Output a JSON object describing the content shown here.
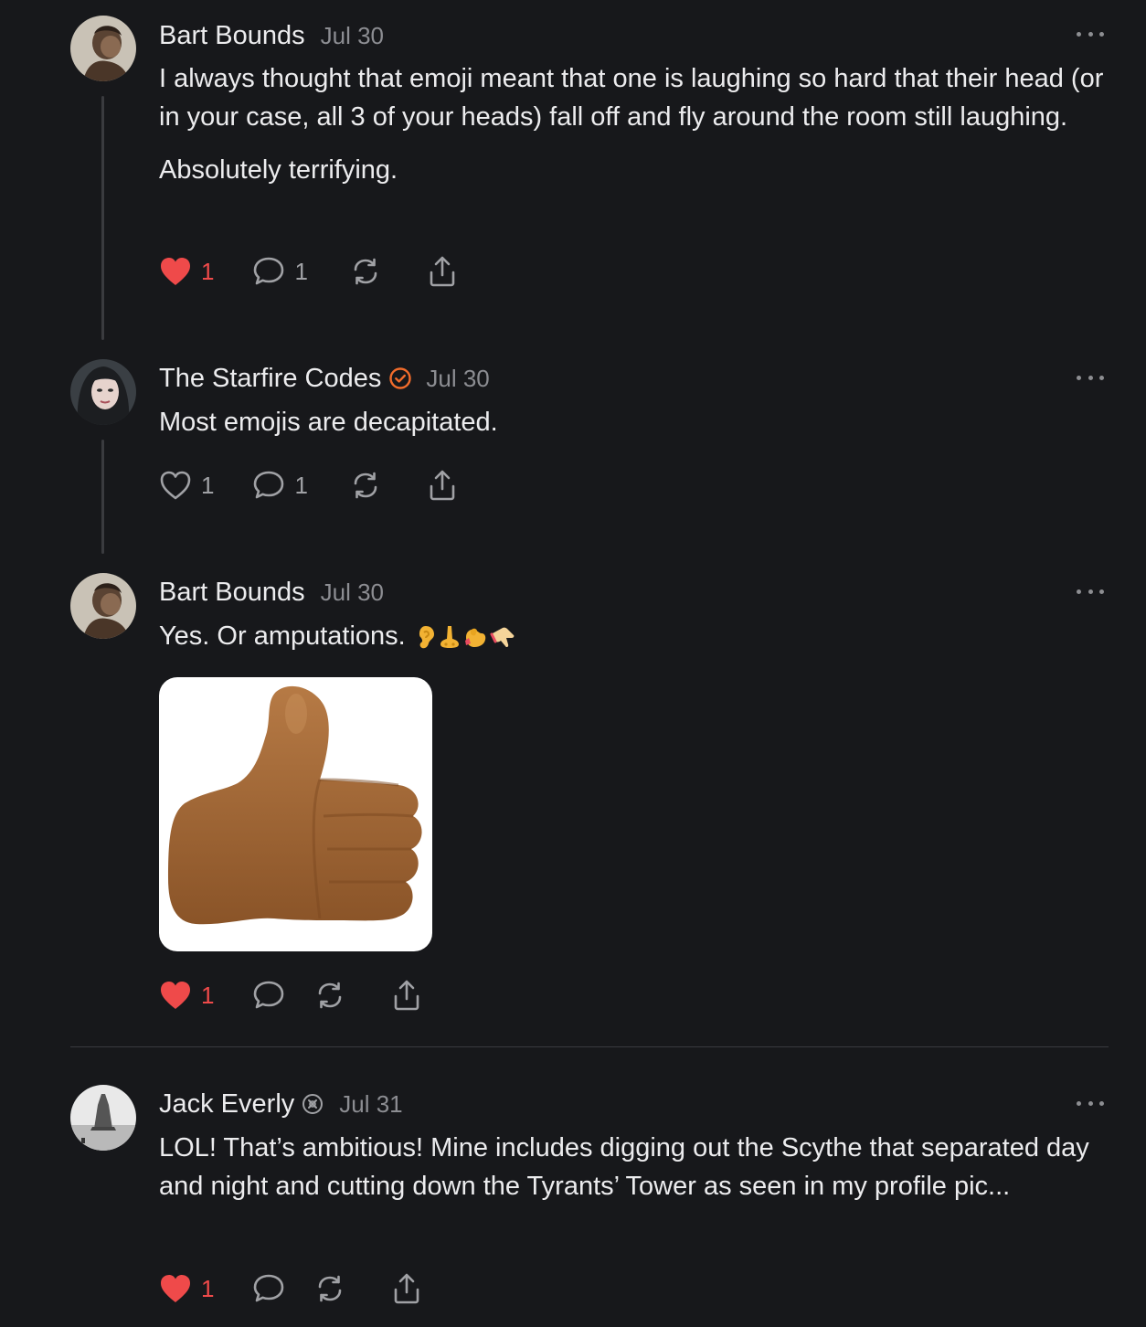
{
  "thread": [
    {
      "author": "Bart Bounds",
      "date": "Jul 30",
      "paragraphs": [
        "I always thought that emoji meant that one is laughing so hard that their head (or in your case, all 3 of your heads) fall off and fly around the room still laughing.",
        "Absolutely terrifying."
      ],
      "likes": "1",
      "comments": "1"
    },
    {
      "author": "The Starfire Codes",
      "date": "Jul 30",
      "paragraphs": [
        "Most emojis are decapitated."
      ],
      "likes": "1",
      "comments": "1"
    },
    {
      "author": "Bart Bounds",
      "date": "Jul 30",
      "paragraphs": [
        "Yes. Or amputations."
      ],
      "emojis": [
        "ear",
        "nose",
        "flexed-arm",
        "hand"
      ],
      "likes": "1"
    },
    {
      "author": "Jack Everly",
      "date": "Jul 31",
      "paragraphs": [
        "LOL! That’s ambitious! Mine includes digging out the Scythe that separated day and night and cutting down the Tyrants’ Tower as seen in my profile pic..."
      ],
      "likes": "1"
    }
  ],
  "colors": {
    "background": "#17181b",
    "liked": "#ef4a4a",
    "badge_orange": "#f26c2b",
    "muted": "#8c8d92"
  },
  "icons": [
    "heart-icon",
    "comment-icon",
    "restack-icon",
    "share-icon",
    "more-icon",
    "verified-badge-icon"
  ]
}
